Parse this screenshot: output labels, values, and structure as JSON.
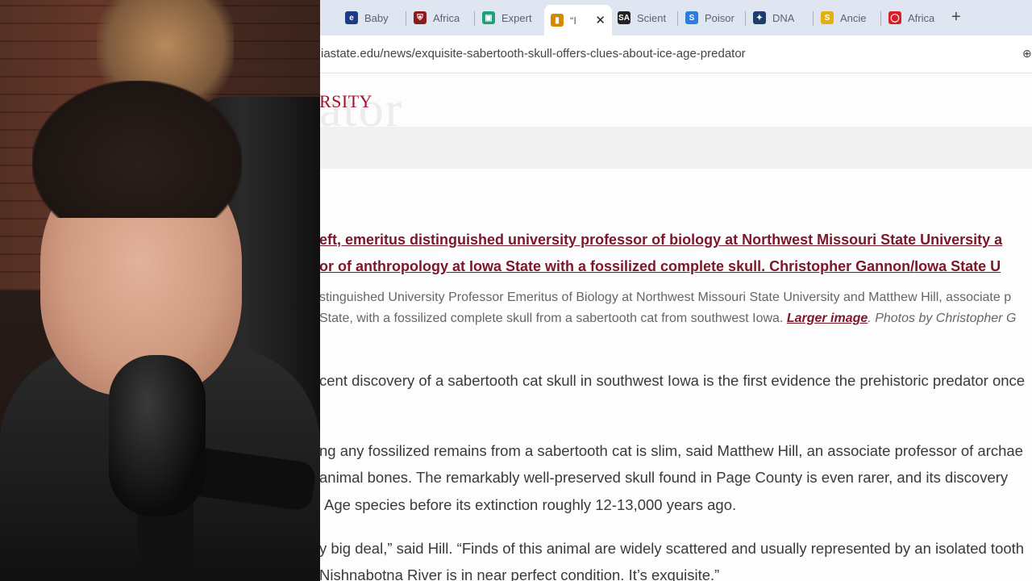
{
  "browser": {
    "tabs": [
      {
        "title": "Baby",
        "icon": "e-circle-icon",
        "color": "#1a3a8a",
        "glyph": "e"
      },
      {
        "title": "Africa",
        "icon": "university-crest-icon",
        "color": "#8b1a1a",
        "glyph": "⛨"
      },
      {
        "title": "Expert",
        "icon": "expert-logo-icon",
        "color": "#1aa37a",
        "glyph": "▣"
      },
      {
        "title": "“I",
        "icon": "flag-icon",
        "color": "#d48a00",
        "glyph": "▮"
      },
      {
        "title": "Scient",
        "icon": "sciam-logo-icon",
        "color": "#222222",
        "glyph": "SA"
      },
      {
        "title": "Poisor",
        "icon": "s-logo-icon",
        "color": "#2a7de1",
        "glyph": "S"
      },
      {
        "title": "DNA",
        "icon": "compass-icon",
        "color": "#1d3d6b",
        "glyph": "✦"
      },
      {
        "title": "Ancie",
        "icon": "s-coin-icon",
        "color": "#e3b00f",
        "glyph": "S"
      },
      {
        "title": "Africa",
        "icon": "speech-bubble-icon",
        "color": "#d81f26",
        "glyph": "◯"
      }
    ],
    "active_tab_index": 3,
    "close_glyph": "✕",
    "new_tab_glyph": "+",
    "url": "iastate.edu/news/exquisite-sabertooth-skull-offers-clues-about-ice-age-predator",
    "zoom_glyph": "⊕"
  },
  "page": {
    "ghost_banner": "ator",
    "brand": "RSITY",
    "caption_link_line1": "eft, emeritus distinguished university professor of biology at Northwest Missouri State University a",
    "caption_link_line2": "or of anthropology at Iowa State with a fossilized complete skull. Christopher Gannon/Iowa State U",
    "caption_line1": "stinguished University Professor Emeritus of Biology at Northwest Missouri State University and Matthew Hill, associate p",
    "caption_line2_a": "State, with a fossilized complete skull from a sabertooth cat from southwest Iowa. ",
    "caption_line2_link": "Larger image",
    "caption_line2_b": ". Photos by Christopher G",
    "para1": "cent discovery of a sabertooth cat skull in southwest Iowa is the first evidence the prehistoric predator once",
    "para2_line1": "ng any fossilized remains from a sabertooth cat is slim, said Matthew Hill, an associate professor of archae",
    "para2_line2": "animal bones. The remarkably well-preserved skull found in Page County is even rarer, and its discovery",
    "para2_line3": "Age species before its extinction roughly 12-13,000 years ago.",
    "para3_line1": "y big deal,” said Hill. “Finds of this animal are widely scattered and usually represented by an isolated tooth",
    "para3_line2": "Nishnabotna River is in near perfect condition. It’s exquisite.”"
  },
  "colors": {
    "tabstrip": "#dfe6f2",
    "brand": "#a3102f",
    "link": "#7c1729"
  }
}
